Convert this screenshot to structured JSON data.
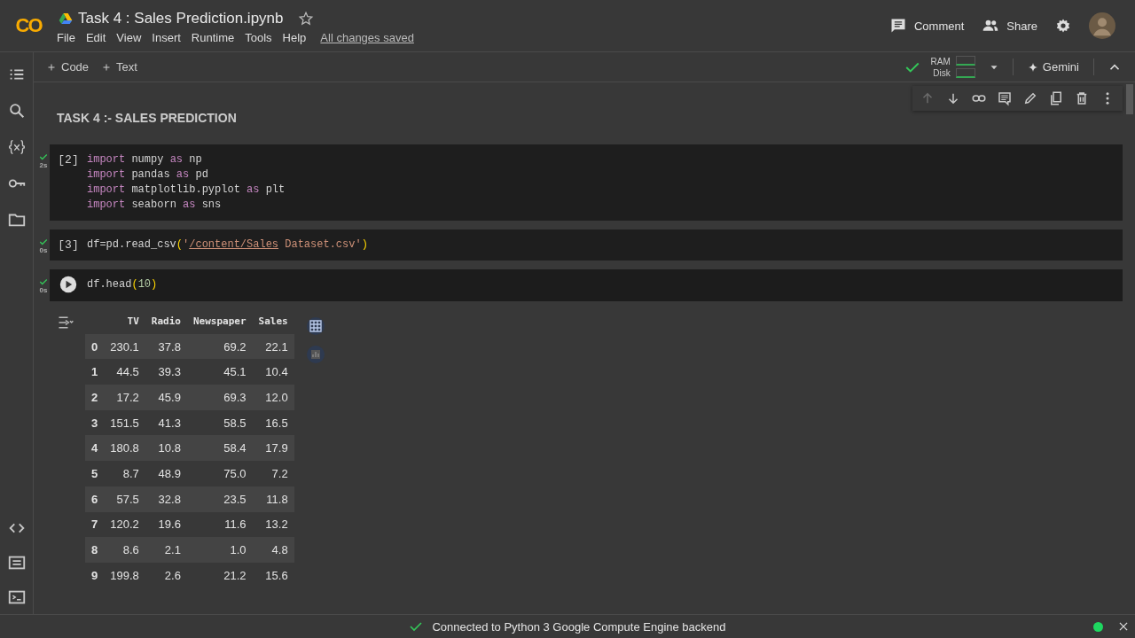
{
  "header": {
    "logo": "CO",
    "title": "Task 4 : Sales Prediction.ipynb",
    "starred": false,
    "menu": [
      "File",
      "Edit",
      "View",
      "Insert",
      "Runtime",
      "Tools",
      "Help"
    ],
    "save_status": "All changes saved",
    "actions": [
      {
        "kind": "comment",
        "label": "Comment"
      },
      {
        "kind": "share",
        "label": "Share"
      }
    ]
  },
  "toolbar": {
    "add_buttons": [
      {
        "label": "Code"
      },
      {
        "label": "Text"
      }
    ],
    "resources": {
      "connected": true,
      "ram_label": "RAM",
      "disk_label": "Disk"
    },
    "gemini": "Gemini"
  },
  "sidebar": {
    "top": [
      {
        "kind": "toc"
      },
      {
        "kind": "search"
      },
      {
        "kind": "variables"
      },
      {
        "kind": "secrets"
      },
      {
        "kind": "files"
      }
    ],
    "bottom": [
      {
        "kind": "code"
      },
      {
        "kind": "terminal-list"
      },
      {
        "kind": "terminal"
      }
    ]
  },
  "cell_tools": [
    {
      "kind": "up",
      "disabled": true
    },
    {
      "kind": "down",
      "disabled": false
    },
    {
      "kind": "link",
      "disabled": false
    },
    {
      "kind": "comment",
      "disabled": false
    },
    {
      "kind": "edit",
      "disabled": false
    },
    {
      "kind": "mirror",
      "disabled": false
    },
    {
      "kind": "delete",
      "disabled": false
    },
    {
      "kind": "more",
      "disabled": false
    }
  ],
  "cells": [
    {
      "kind": "text",
      "heading": "TASK 4 :- SALES PREDICTION"
    },
    {
      "kind": "code",
      "prompt": "[2]",
      "ok": true,
      "time": "2s",
      "focused": false,
      "lines": [
        [
          {
            "t": "import",
            "kind": "kw"
          },
          {
            "t": " numpy ",
            "kind": "plain"
          },
          {
            "t": "as",
            "kind": "kw"
          },
          {
            "t": " np",
            "kind": "plain"
          }
        ],
        [
          {
            "t": "import",
            "kind": "kw"
          },
          {
            "t": " pandas ",
            "kind": "plain"
          },
          {
            "t": "as",
            "kind": "kw"
          },
          {
            "t": " pd",
            "kind": "plain"
          }
        ],
        [
          {
            "t": "import",
            "kind": "kw"
          },
          {
            "t": " matplotlib.pyplot ",
            "kind": "plain"
          },
          {
            "t": "as",
            "kind": "kw"
          },
          {
            "t": " plt",
            "kind": "plain"
          }
        ],
        [
          {
            "t": "import",
            "kind": "kw"
          },
          {
            "t": " seaborn ",
            "kind": "plain"
          },
          {
            "t": "as",
            "kind": "kw"
          },
          {
            "t": " sns",
            "kind": "plain"
          }
        ]
      ]
    },
    {
      "kind": "code",
      "prompt": "[3]",
      "ok": true,
      "time": "0s",
      "focused": false,
      "lines": [
        [
          {
            "t": "df=pd.read_csv",
            "kind": "plain"
          },
          {
            "t": "(",
            "kind": "paren"
          },
          {
            "t": "'",
            "kind": "str"
          },
          {
            "t": "/content/Sales",
            "kind": "link"
          },
          {
            "t": " Dataset.csv'",
            "kind": "str"
          },
          {
            "t": ")",
            "kind": "paren"
          }
        ]
      ]
    },
    {
      "kind": "code",
      "ok": true,
      "time": "0s",
      "focused": true,
      "lines": [
        [
          {
            "t": "df.head",
            "kind": "plain"
          },
          {
            "t": "(",
            "kind": "paren"
          },
          {
            "t": "10",
            "kind": "num"
          },
          {
            "t": ")",
            "kind": "paren"
          }
        ]
      ],
      "output": {
        "columns": [
          "",
          "TV",
          "Radio",
          "Newspaper",
          "Sales"
        ],
        "rows": [
          [
            "0",
            "230.1",
            "37.8",
            "69.2",
            "22.1"
          ],
          [
            "1",
            "44.5",
            "39.3",
            "45.1",
            "10.4"
          ],
          [
            "2",
            "17.2",
            "45.9",
            "69.3",
            "12.0"
          ],
          [
            "3",
            "151.5",
            "41.3",
            "58.5",
            "16.5"
          ],
          [
            "4",
            "180.8",
            "10.8",
            "58.4",
            "17.9"
          ],
          [
            "5",
            "8.7",
            "48.9",
            "75.0",
            "7.2"
          ],
          [
            "6",
            "57.5",
            "32.8",
            "23.5",
            "11.8"
          ],
          [
            "7",
            "120.2",
            "19.6",
            "11.6",
            "13.2"
          ],
          [
            "8",
            "8.6",
            "2.1",
            "1.0",
            "4.8"
          ],
          [
            "9",
            "199.8",
            "2.6",
            "21.2",
            "15.6"
          ]
        ]
      }
    }
  ],
  "status_bar": {
    "connected": true,
    "message": "Connected to Python 3 Google Compute Engine backend"
  }
}
